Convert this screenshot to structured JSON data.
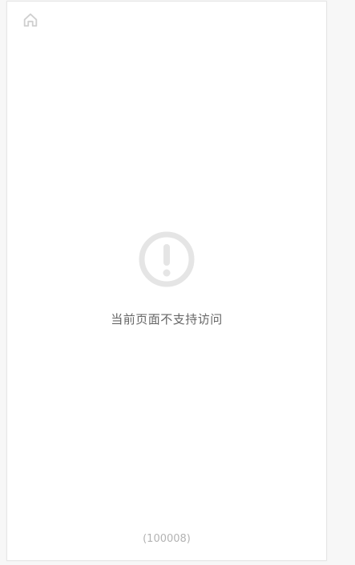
{
  "header": {
    "home_icon": "home-icon"
  },
  "main": {
    "icon": "exclamation-circle-icon",
    "message": "当前页面不支持访问"
  },
  "footer": {
    "error_code": "(100008)"
  },
  "colors": {
    "background": "#f7f7f7",
    "card": "#ffffff",
    "icon": "#e5e5e5",
    "message_text": "#666666",
    "code_text": "#b3b3b3"
  }
}
